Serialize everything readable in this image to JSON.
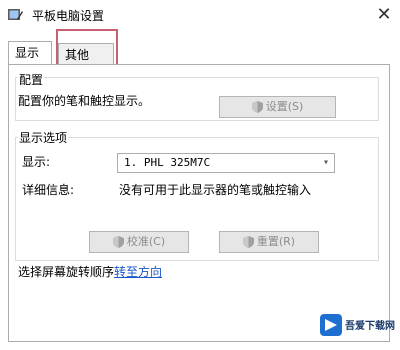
{
  "window": {
    "title": "平板电脑设置"
  },
  "tabs": [
    {
      "label": "显示"
    },
    {
      "label": "其他"
    }
  ],
  "config_group": {
    "title": "配置",
    "description": "配置你的笔和触控显示。",
    "setup_button": "设置(S)"
  },
  "display_options": {
    "title": "显示选项",
    "display_label": "显示:",
    "display_value": "1. PHL 325M7C",
    "details_label": "详细信息:",
    "details_value": "没有可用于此显示器的笔或触控输入",
    "calibrate_button": "校准(C)",
    "reset_button": "重置(R)"
  },
  "rotation": {
    "prefix": "选择屏幕旋转顺序",
    "link": "转至方向"
  },
  "watermark": {
    "text": "吾爱下载网"
  },
  "colors": {
    "highlight_box": "#c76072",
    "link": "#1a56c7"
  }
}
